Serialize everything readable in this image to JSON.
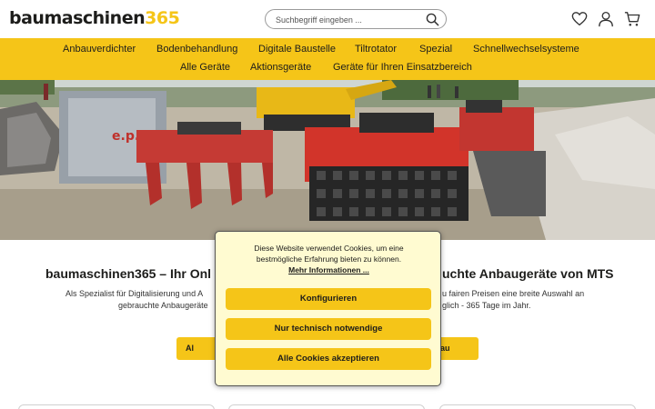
{
  "header": {
    "logo_text": "baumaschinen",
    "logo_num": "365",
    "search_placeholder": "Suchbegriff eingeben ..."
  },
  "nav": {
    "row1": [
      "Anbauverdichter",
      "Bodenbehandlung",
      "Digitale Baustelle",
      "Tiltrotator",
      "Spezial",
      "Schnellwechselsysteme"
    ],
    "row2": [
      "Alle Geräte",
      "Aktionsgeräte",
      "Geräte für Ihren Einsatzbereich"
    ]
  },
  "hero": {
    "machine_label": "e.p.r"
  },
  "content": {
    "headline_left": "baumaschinen365 – Ihr Onl",
    "headline_right": "uchte Anbaugeräte von MTS",
    "para_line1_left": "Als Spezialist für Digitalisierung und A",
    "para_line1_right": "u fairen Preisen eine breite Auswahl an",
    "para_line2_left": "gebrauchte Anbaugeräte",
    "para_line2_right": "glich - 365 Tage im Jahr.",
    "button_left": "Al",
    "button_right": "au"
  },
  "cookie": {
    "text_line1": "Diese Website verwendet Cookies, um eine",
    "text_line2": "bestmögliche Erfahrung bieten zu können.",
    "more_info": "Mehr Informationen ...",
    "btn_configure": "Konfigurieren",
    "btn_necessary": "Nur technisch notwendige",
    "btn_accept_all": "Alle Cookies akzeptieren"
  },
  "colors": {
    "brand_yellow": "#f5c518",
    "dialog_bg": "#fffbd1",
    "machine_red": "#d2342a"
  }
}
